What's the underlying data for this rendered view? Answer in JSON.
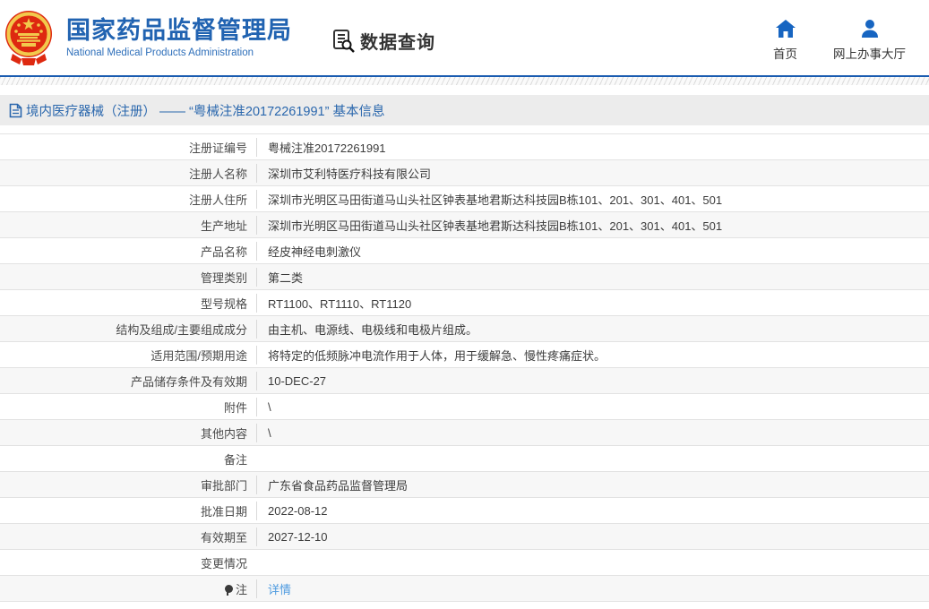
{
  "header": {
    "title": "国家药品监督管理局",
    "subtitle": "National Medical Products Administration",
    "section_label": "数据查询",
    "nav": [
      {
        "label": "首页",
        "icon": "home-icon"
      },
      {
        "label": "网上办事大厅",
        "icon": "user-icon"
      }
    ]
  },
  "breadcrumb": {
    "icon": "document-icon",
    "text": "境内医疗器械（注册） —— “粤械注准20172261991” 基本信息"
  },
  "colors": {
    "brand_blue": "#2163b1",
    "header_line_blue": "#1a5cb0",
    "nav_icon_blue": "#1765c1",
    "breadcrumb_text_blue": "#2a67ad",
    "link_blue": "#4e9be0",
    "row_alt_gray": "#f7f7f7",
    "border_gray": "#e2e2e2",
    "emblem_red": "#de2910",
    "emblem_gold": "#f2c94c"
  },
  "table": {
    "rows": [
      {
        "label": "注册证编号",
        "value": "粤械注准20172261991"
      },
      {
        "label": "注册人名称",
        "value": "深圳市艾利特医疗科技有限公司"
      },
      {
        "label": "注册人住所",
        "value": "深圳市光明区马田街道马山头社区钟表基地君斯达科技园B栋101、201、301、401、501"
      },
      {
        "label": "生产地址",
        "value": "深圳市光明区马田街道马山头社区钟表基地君斯达科技园B栋101、201、301、401、501"
      },
      {
        "label": "产品名称",
        "value": "经皮神经电刺激仪"
      },
      {
        "label": "管理类别",
        "value": "第二类"
      },
      {
        "label": "型号规格",
        "value": "RT1100、RT1110、RT1120"
      },
      {
        "label": "结构及组成/主要组成成分",
        "value": "由主机、电源线、电极线和电极片组成。"
      },
      {
        "label": "适用范围/预期用途",
        "value": "将特定的低频脉冲电流作用于人体，用于缓解急、慢性疼痛症状。"
      },
      {
        "label": "产品储存条件及有效期",
        "value": "10-DEC-27"
      },
      {
        "label": "附件",
        "value": "\\"
      },
      {
        "label": "其他内容",
        "value": "\\"
      },
      {
        "label": "备注",
        "value": ""
      },
      {
        "label": "审批部门",
        "value": "广东省食品药品监督管理局"
      },
      {
        "label": "批准日期",
        "value": "2022-08-12"
      },
      {
        "label": "有效期至",
        "value": "2027-12-10"
      },
      {
        "label": "变更情况",
        "value": ""
      },
      {
        "label": "注",
        "value": "详情",
        "value_is_link": true,
        "label_icon": "note-icon"
      }
    ]
  }
}
